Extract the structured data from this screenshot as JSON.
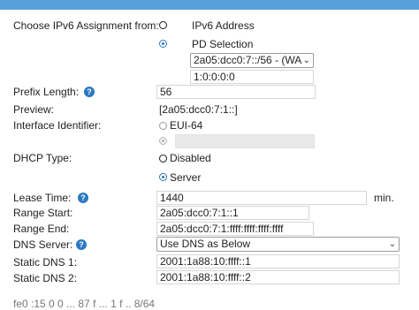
{
  "form": {
    "assignment_label": "Choose IPv6 Assignment from:",
    "option_ipv6_address": "IPv6 Address",
    "option_pd_selection": "PD Selection",
    "pd_select_value": "2a05:dcc0:7::/56 - (WA",
    "pd_suffix_value": "1:0:0:0:0",
    "prefix_length_label": "Prefix Length:",
    "prefix_length_value": "56",
    "preview_label": "Preview:",
    "preview_value": "[2a05:dcc0:7:1::]",
    "interface_id_label": "Interface Identifier:",
    "option_eui64": "EUI-64",
    "interface_id_value": "",
    "dhcp_type_label": "DHCP Type:",
    "option_disabled": "Disabled",
    "option_server": "Server",
    "lease_time_label": "Lease Time:",
    "lease_time_value": "1440",
    "lease_unit": "min.",
    "range_start_label": "Range Start:",
    "range_start_value": "2a05:dcc0:7:1::1",
    "range_end_label": "Range End:",
    "range_end_value": "2a05:dcc0:7:1:ffff:ffff:ffff:ffff",
    "dns_server_label": "DNS Server:",
    "dns_server_value": "Use DNS as Below",
    "static_dns1_label": "Static DNS 1:",
    "static_dns1_value": "2001:1a88:10:ffff::1",
    "static_dns2_label": "Static DNS 2:",
    "static_dns2_value": "2001:1a88:10:ffff::2",
    "cutoff_text": "fe0 :15 0 0 ... 87 f ... 1 f .. 8/64"
  },
  "icons": {
    "help": "help-icon",
    "dropdown": "chevron-down-icon"
  },
  "colors": {
    "accent": "#2b78c2",
    "header_strip": "#5aa0d8"
  }
}
